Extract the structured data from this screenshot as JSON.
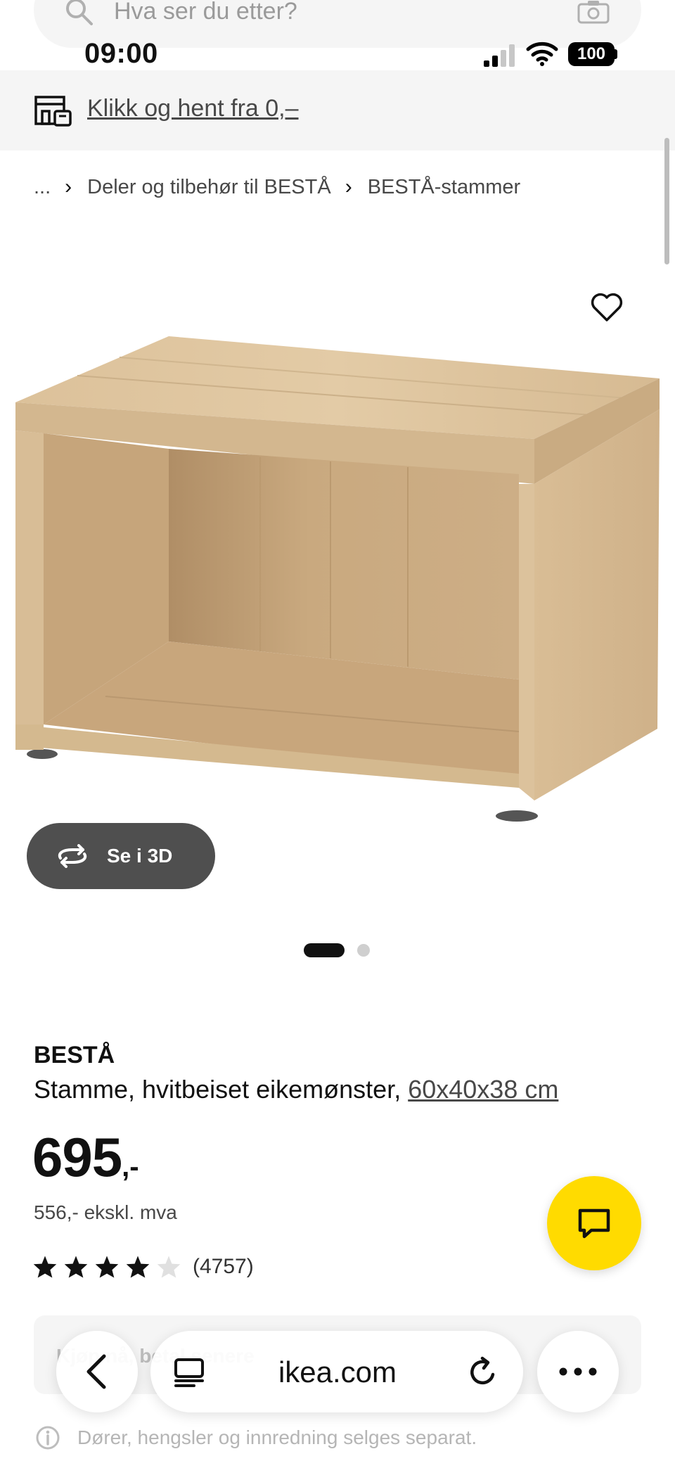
{
  "search": {
    "placeholder": "Hva ser du etter?"
  },
  "status_bar": {
    "time": "09:00",
    "battery": "100"
  },
  "store_banner": {
    "link": "Klikk og hent fra 0,–"
  },
  "breadcrumb": {
    "ellipsis": "...",
    "items": [
      "Deler og tilbehør til BESTÅ",
      "BESTÅ-stammer"
    ]
  },
  "gallery": {
    "view_3d_label": "Se i 3D",
    "slides_total": 2,
    "active_slide": 1
  },
  "product": {
    "name": "BESTÅ",
    "description": "Stamme, hvitbeiset eikemønster,",
    "size": "60x40x38 cm",
    "price": "695",
    "price_suffix": ",-",
    "price_ex_vat": "556,- ekskl. mva",
    "rating": 4,
    "rating_max": 5,
    "review_count": "(4757)"
  },
  "promo": {
    "text": "Kjøp nå, betal senere"
  },
  "browser": {
    "url": "ikea.com"
  },
  "notice": {
    "text": "Dører, hengsler og innredning selges separat."
  },
  "colors": {
    "accent_yellow": "#ffdb00",
    "button_dark": "#4f4f4f",
    "text": "#111111",
    "muted": "#484848"
  }
}
